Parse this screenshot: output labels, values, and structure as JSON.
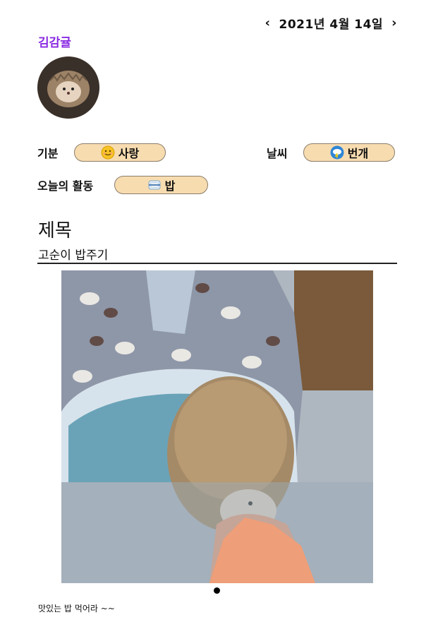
{
  "date_nav": {
    "prev_icon": "chevron-left-icon",
    "next_icon": "chevron-right-icon",
    "date": "2021년 4월 14일"
  },
  "user": {
    "name": "김감귤",
    "avatar_icon": "hedgehog-avatar"
  },
  "mood": {
    "label": "기분",
    "value": "사랑",
    "icon": "smiley-icon"
  },
  "weather": {
    "label": "날씨",
    "value": "번개",
    "icon": "thunder-cloud-icon"
  },
  "activity": {
    "label": "오늘의 활동",
    "value": "밥",
    "icon": "rice-bowl-icon"
  },
  "entry": {
    "title_heading": "제목",
    "title": "고순이 밥주기",
    "photo_icon": "hedgehog-photo",
    "body": "맛있는 밥 먹어라 ~~"
  },
  "colors": {
    "accent": "#8a2be2",
    "pill_bg": "#f7dcb0",
    "pill_border": "#8b7d6b"
  }
}
